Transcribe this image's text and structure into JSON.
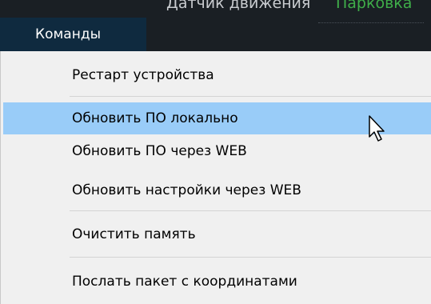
{
  "background": {
    "sensor_label": "Датчик движения",
    "sensor_value": "Парковка"
  },
  "menu": {
    "title": "Команды",
    "items": [
      {
        "label": "Рестарт устройства",
        "highlighted": false
      },
      {
        "label": "Обновить ПО локально",
        "highlighted": true
      },
      {
        "label": "Обновить ПО через WEB",
        "highlighted": false
      },
      {
        "label": "Обновить настройки через WEB",
        "highlighted": false
      },
      {
        "label": "Очистить память",
        "highlighted": false
      },
      {
        "label": "Послать пакет с координатами",
        "highlighted": false
      }
    ]
  },
  "colors": {
    "topbar": "#1a1f24",
    "menu_title_bg": "#0f2a3f",
    "sensor_value": "#3fae49",
    "menu_bg": "#f0f0f0",
    "highlight": "#99ccf8"
  },
  "icons": {
    "cursor": "mouse-pointer-icon"
  }
}
